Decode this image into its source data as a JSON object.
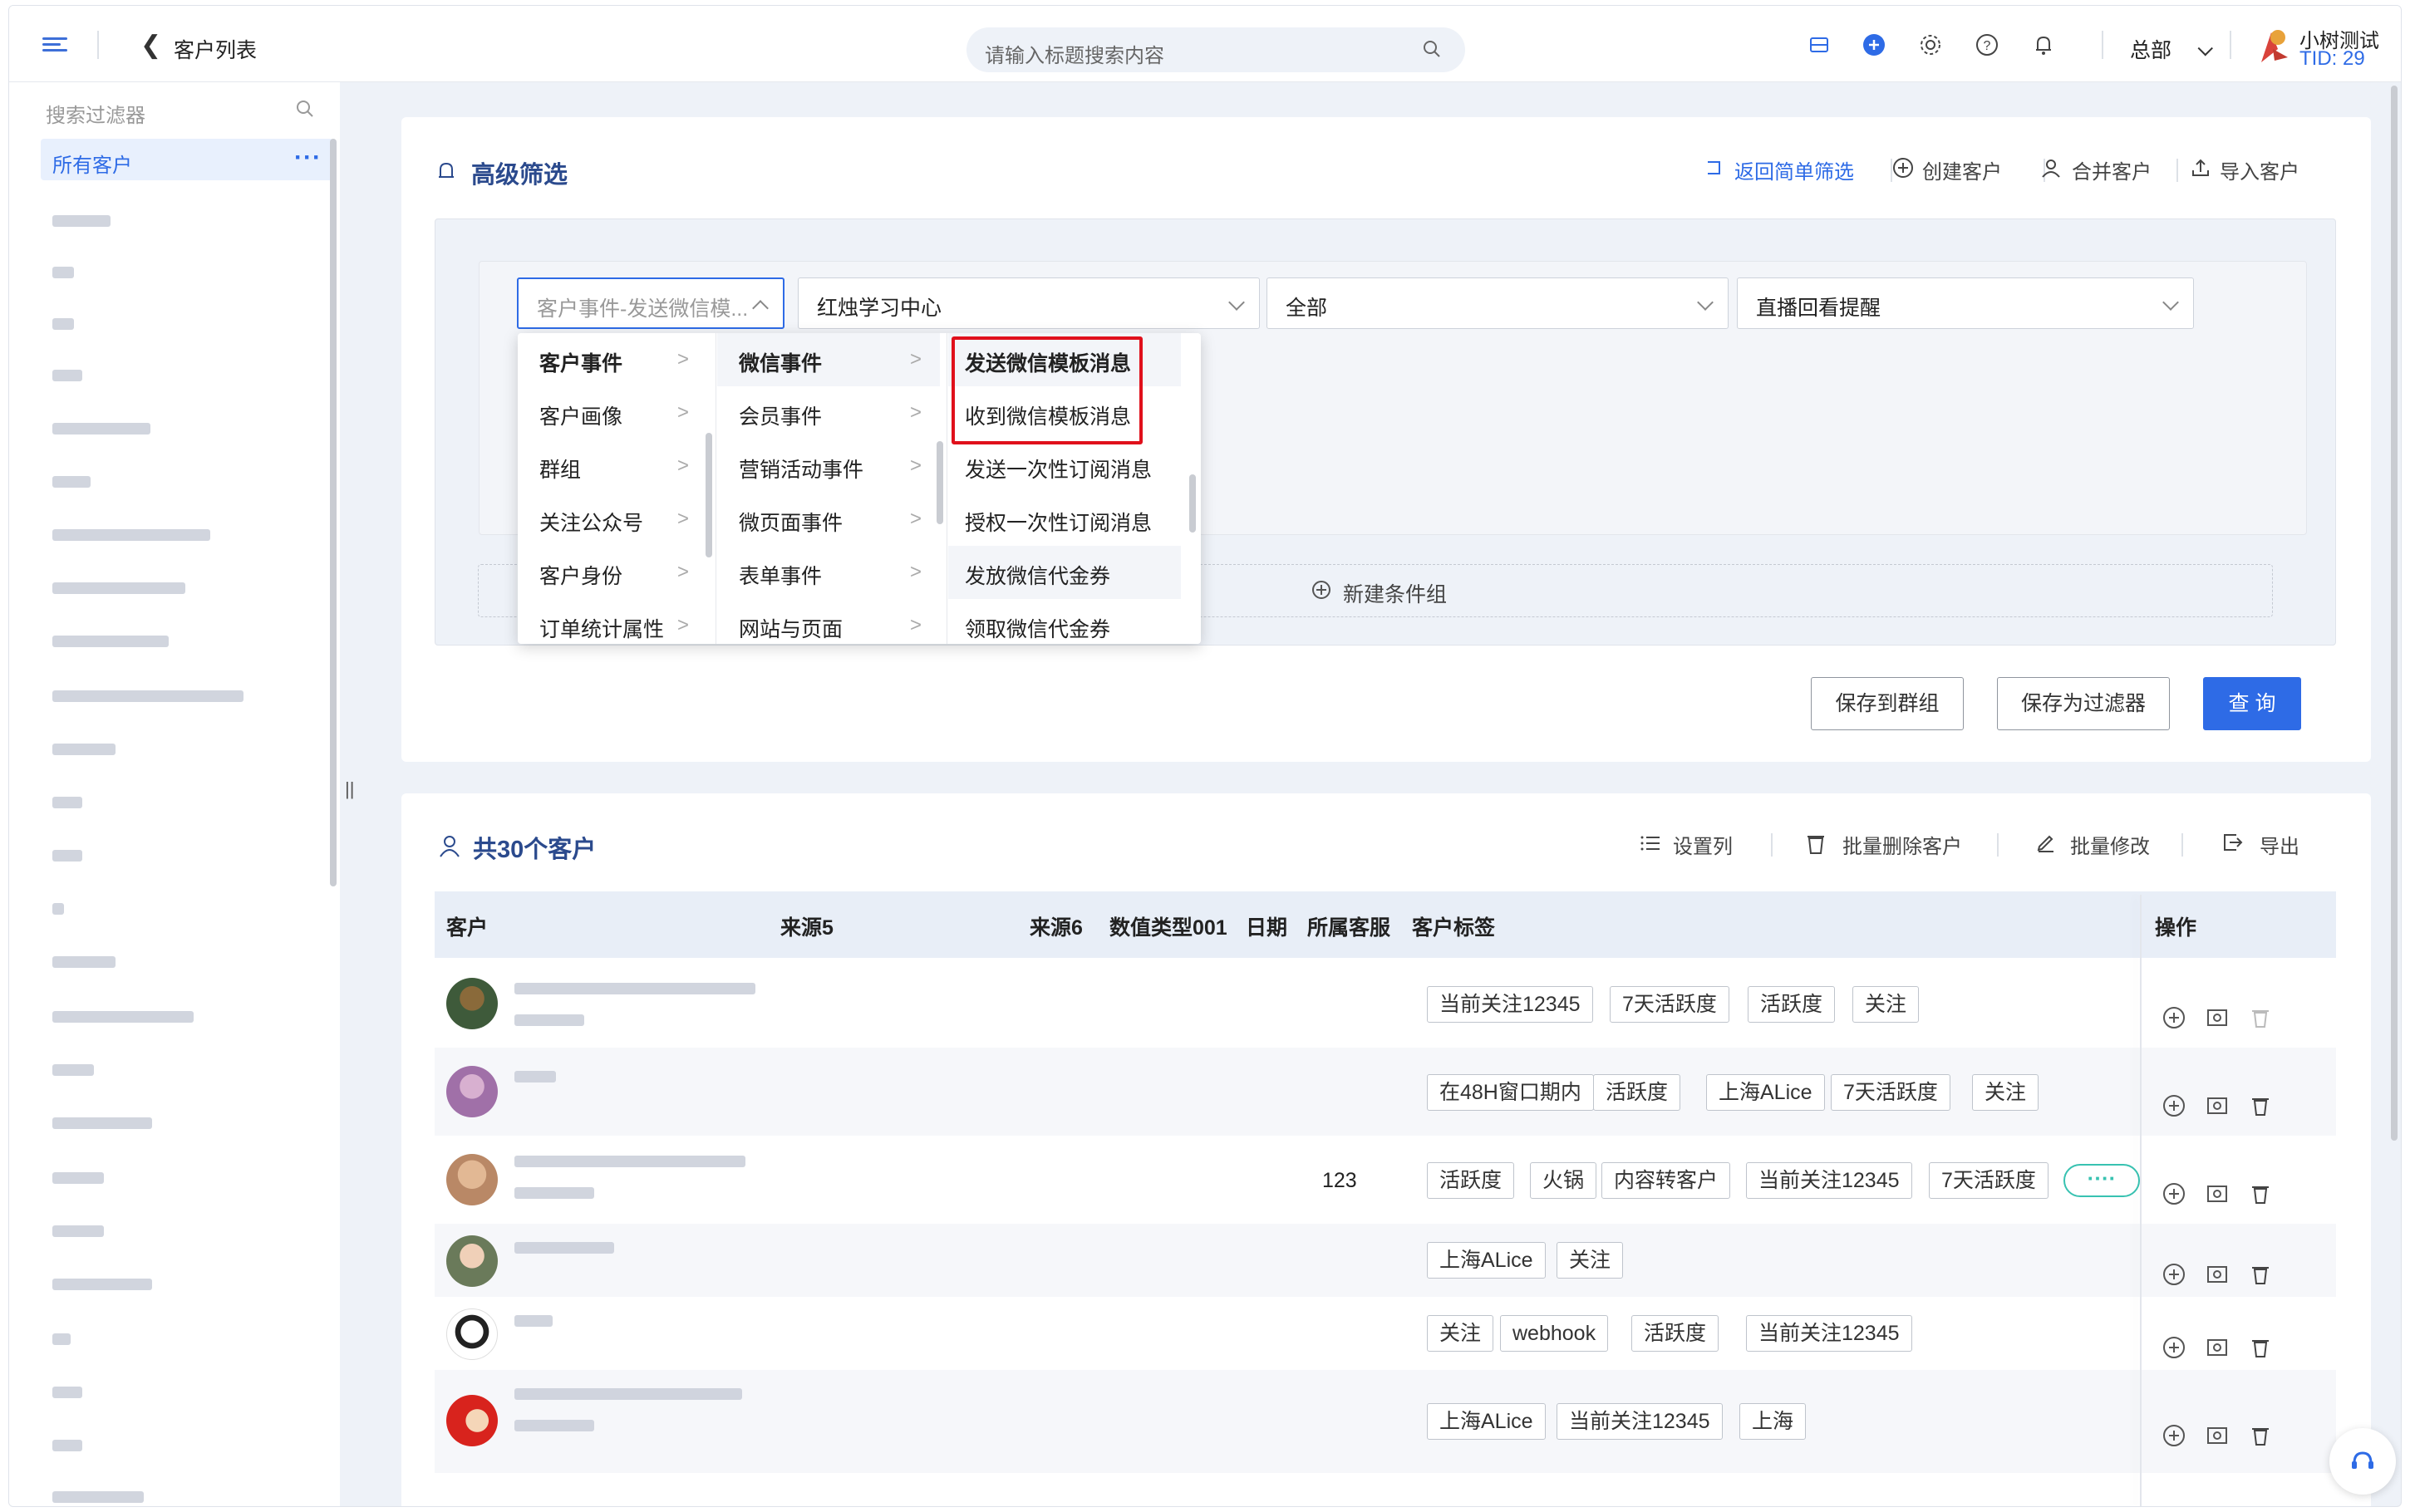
{
  "header": {
    "back_title": "客户列表",
    "search_placeholder": "请输入标题搜索内容",
    "org": "总部",
    "user_name": "小树测试",
    "tid": "TID: 29"
  },
  "sidebar": {
    "search_placeholder": "搜索过滤器",
    "selected_item": "所有客户",
    "more": "···"
  },
  "filter": {
    "title": "高级筛选",
    "actions": {
      "back_simple": "返回简单筛选",
      "create_customer": "创建客户",
      "merge_customer": "合并客户",
      "import_customer": "导入客户"
    },
    "selects": [
      {
        "value": "客户事件-发送微信模...",
        "placeholder": true
      },
      {
        "value": "红烛学习中心"
      },
      {
        "value": "全部"
      },
      {
        "value": "直播回看提醒"
      }
    ],
    "new_group": "新建条件组",
    "buttons": {
      "save_group": "保存到群组",
      "save_filter": "保存为过滤器",
      "query": "查 询"
    }
  },
  "cascade": {
    "col1": [
      "客户事件",
      "客户画像",
      "群组",
      "关注公众号",
      "客户身份",
      "订单统计属性"
    ],
    "col2": [
      "微信事件",
      "会员事件",
      "营销活动事件",
      "微页面事件",
      "表单事件",
      "网站与页面"
    ],
    "col3": [
      "发送微信模板消息",
      "收到微信模板消息",
      "发送一次性订阅消息",
      "授权一次性订阅消息",
      "发放微信代金券",
      "领取微信代金券"
    ]
  },
  "customers": {
    "title": "共30个客户",
    "actions": {
      "set_columns": "设置列",
      "batch_delete": "批量删除客户",
      "batch_edit": "批量修改",
      "export": "导出"
    },
    "columns": [
      "客户",
      "来源5",
      "来源6",
      "数值类型001",
      "日期",
      "所属客服",
      "客户标签",
      "操作"
    ],
    "rows": [
      {
        "value": "",
        "tags": [
          "当前关注12345",
          "7天活跃度",
          "活跃度",
          "关注"
        ]
      },
      {
        "value": "",
        "tags": [
          "在48H窗口期内",
          "活跃度",
          "上海ALice",
          "7天活跃度",
          "关注"
        ]
      },
      {
        "value": "123",
        "tags": [
          "活跃度",
          "火锅",
          "内容转客户",
          "当前关注12345",
          "7天活跃度"
        ],
        "more": "····"
      },
      {
        "value": "",
        "tags": [
          "上海ALice",
          "关注"
        ]
      },
      {
        "value": "",
        "tags": [
          "关注",
          "webhook",
          "活跃度",
          "当前关注12345"
        ]
      },
      {
        "value": "",
        "tags": [
          "上海ALice",
          "当前关注12345",
          "上海"
        ]
      }
    ]
  },
  "colors": {
    "primary": "#2e6be6",
    "highlight_red": "#e0101b",
    "title_blue": "#2b4a8d",
    "teal": "#38c2b1"
  }
}
